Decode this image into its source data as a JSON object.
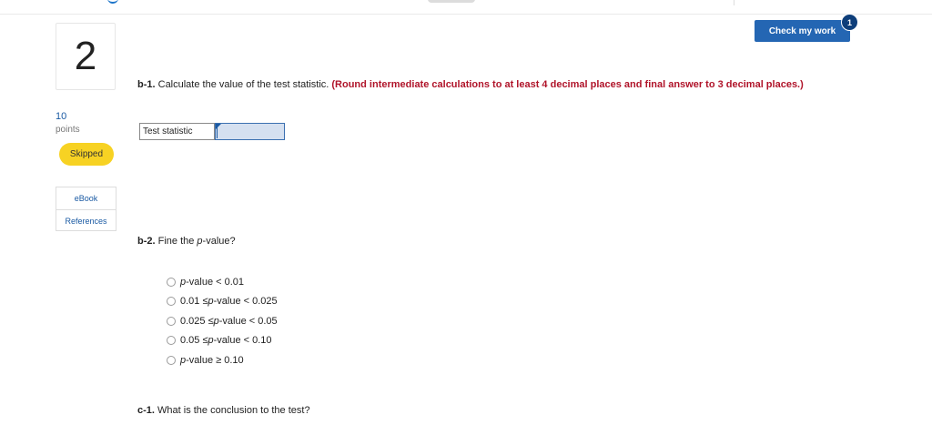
{
  "question": {
    "number": "2",
    "points_value": "10",
    "points_label": "points",
    "status_badge": "Skipped"
  },
  "resources": {
    "ebook": "eBook",
    "references": "References"
  },
  "header": {
    "check_label": "Check my work",
    "check_count": "1"
  },
  "b1": {
    "prefix": "b-1.",
    "text": " Calculate the value of the test statistic. ",
    "instruction": "(Round intermediate calculations to at least 4 decimal places and final answer to 3 decimal places.)",
    "input_label": "Test statistic",
    "input_value": ""
  },
  "b2": {
    "prefix": "b-2.",
    "text_pre": " Fine the ",
    "text_em": "p",
    "text_post": "-value?",
    "options": [
      {
        "a": "",
        "em": "p",
        "b": "-value < 0.01"
      },
      {
        "a": "0.01 ≤ ",
        "em": "p",
        "b": "-value < 0.025"
      },
      {
        "a": "0.025 ≤ ",
        "em": "p",
        "b": "-value < 0.05"
      },
      {
        "a": "0.05 ≤ ",
        "em": "p",
        "b": "-value < 0.10"
      },
      {
        "a": "",
        "em": "p",
        "b": "-value ≥ 0.10"
      }
    ]
  },
  "c1": {
    "prefix": "c-1.",
    "text": " What is the conclusion to the test?"
  }
}
